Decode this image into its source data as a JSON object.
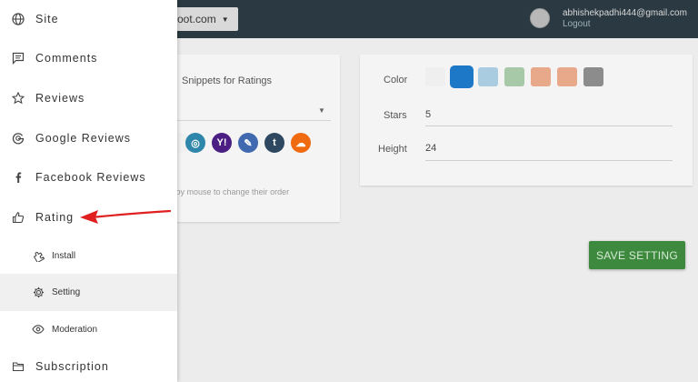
{
  "topbar": {
    "site_select_value": "oot.com",
    "user_email": "abhishekpadhi444@gmail.com",
    "logout_label": "Logout"
  },
  "snippets_card": {
    "title": "Snippets for Ratings",
    "hint": "d by mouse to change their order",
    "social_icons": [
      {
        "name": "instagram-icon",
        "glyph": "◎",
        "color": "#2e86ab"
      },
      {
        "name": "yahoo-icon",
        "glyph": "Y!",
        "color": "#4a1e82"
      },
      {
        "name": "paperclip-icon",
        "glyph": "✎",
        "color": "#4169b0"
      },
      {
        "name": "tumblr-icon",
        "glyph": "t",
        "color": "#2d4860"
      },
      {
        "name": "soundcloud-icon",
        "glyph": "☁",
        "color": "#f06a12"
      }
    ]
  },
  "settings_card": {
    "color_label": "Color",
    "stars_label": "Stars",
    "stars_value": "5",
    "height_label": "Height",
    "height_value": "24",
    "swatches": [
      "#efefef",
      "#1e78c8",
      "#a9cce0",
      "#a8c9a8",
      "#e8a88a",
      "#e8a88a",
      "#8c8c8c"
    ],
    "selected_swatch": 1
  },
  "save_button_label": "SAVE SETTING",
  "sidebar": {
    "items": [
      {
        "label": "Site",
        "icon": "globe-icon"
      },
      {
        "label": "Comments",
        "icon": "comment-icon"
      },
      {
        "label": "Reviews",
        "icon": "star-icon"
      },
      {
        "label": "Google Reviews",
        "icon": "google-icon"
      },
      {
        "label": "Facebook Reviews",
        "icon": "facebook-icon"
      },
      {
        "label": "Rating",
        "icon": "thumbs-up-icon"
      }
    ],
    "sub_items": [
      {
        "label": "Install",
        "icon": "puzzle-icon"
      },
      {
        "label": "Setting",
        "icon": "gear-icon"
      },
      {
        "label": "Moderation",
        "icon": "eye-icon"
      }
    ],
    "bottom_item": {
      "label": "Subscription",
      "icon": "folder-icon"
    },
    "active_sub_item": 1
  },
  "colors": {
    "arrow": "#e02020",
    "save_button": "#3d8a3f",
    "topbar": "#2b3a42"
  }
}
